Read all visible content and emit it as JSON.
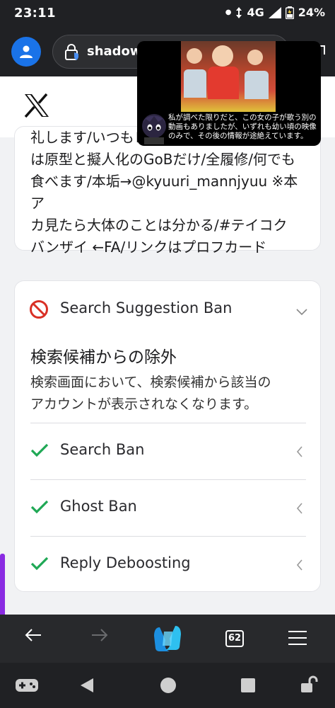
{
  "status_bar": {
    "time": "23:11",
    "network": "4G",
    "battery": "24%"
  },
  "browser": {
    "url": "shadowb"
  },
  "page": {
    "logo": "X",
    "bio_text": "礼します/いつもＨ\nは原型と擬人化のGoBだけ/全履修/何でも\n食べます/本垢→@kyuuri_mannjyuu ※本ア\nカ見たら大体のことは分かる/#テイコク\nバンザイ ←FA/リンクはプロフカード",
    "ban_card": {
      "title": "Search Suggestion Ban",
      "subtitle": "検索候補からの除外",
      "description": "検索画面において、検索候補から該当の\nアカウントが表示されなくなります。",
      "checks": [
        {
          "label": "Search Ban"
        },
        {
          "label": "Ghost Ban"
        },
        {
          "label": "Reply Deboosting"
        }
      ],
      "colors": {
        "ban": "#d93025",
        "check": "#1fa855"
      }
    }
  },
  "video_overlay": {
    "subtitle": "私が調べた限りだと、この女の子が歌う別の\n動画もありましたが、いずれも幼い頃の映像\nのみで、その後の情報が途絶えています。"
  },
  "bottom_bar": {
    "tab_count": "62"
  },
  "colors": {
    "accent_scroll": "#8a2be2",
    "avatar": "#1a73e8"
  }
}
